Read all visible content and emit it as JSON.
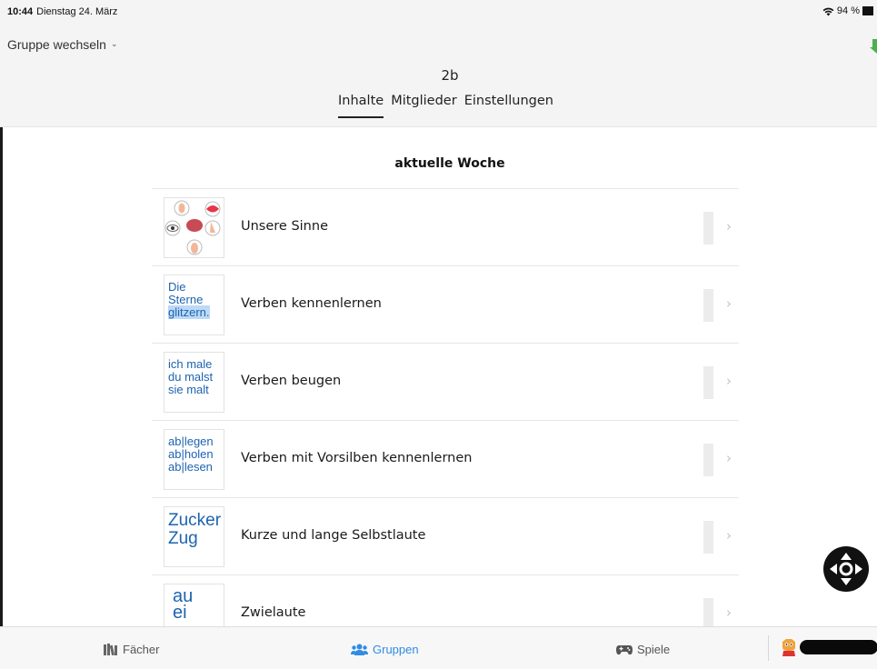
{
  "status_bar": {
    "time": "10:44",
    "date": "Dienstag 24. März",
    "battery": "94 %"
  },
  "header": {
    "group_switch_label": "Gruppe wechseln",
    "group_name": "2b",
    "tabs": [
      {
        "label": "Inhalte",
        "active": true
      },
      {
        "label": "Mitglieder",
        "active": false
      },
      {
        "label": "Einstellungen",
        "active": false
      }
    ]
  },
  "main": {
    "section_title": "aktuelle Woche",
    "items": [
      {
        "label": "Unsere Sinne",
        "thumb": "senses-icons"
      },
      {
        "label": "Verben kennenlernen",
        "thumb_lines": [
          "Die",
          "Sterne",
          "glitzern."
        ]
      },
      {
        "label": "Verben beugen",
        "thumb_lines": [
          "ich male",
          "du malst",
          "sie malt"
        ]
      },
      {
        "label": "Verben mit Vorsilben kennenlernen",
        "thumb_lines": [
          "ab|legen",
          "ab|holen",
          "ab|lesen"
        ]
      },
      {
        "label": "Kurze und lange Selbstlaute",
        "thumb_lines": [
          "Zucker",
          "Zug"
        ]
      },
      {
        "label": "Zwielaute",
        "thumb_lines": [
          "au",
          "ei"
        ]
      }
    ]
  },
  "tab_bar": {
    "faecher": "Fächer",
    "gruppen": "Gruppen",
    "spiele": "Spiele"
  },
  "colors": {
    "accent": "#2f8ce4",
    "thumb_text": "#1e63b0",
    "highlight": "#bcd9f7"
  }
}
